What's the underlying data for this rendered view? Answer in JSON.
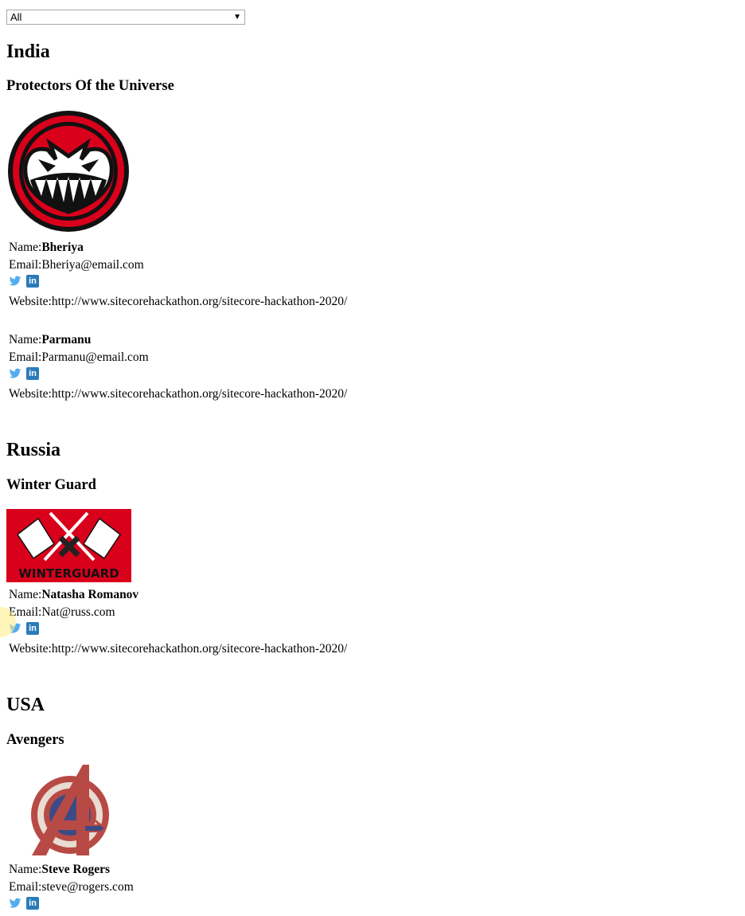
{
  "filter": {
    "selected": "All"
  },
  "sections": [
    {
      "country": "India",
      "team": "Protectors Of the Universe",
      "logo": "angry-face-logo",
      "members": [
        {
          "name_label": "Name:",
          "name": "Bheriya",
          "email_label": "Email:",
          "email": "Bheriya@email.com",
          "website_label": "Website:",
          "website": "http://www.sitecorehackathon.org/sitecore-hackathon-2020/"
        },
        {
          "name_label": "Name:",
          "name": "Parmanu",
          "email_label": "Email:",
          "email": "Parmanu@email.com",
          "website_label": "Website:",
          "website": "http://www.sitecorehackathon.org/sitecore-hackathon-2020/"
        }
      ]
    },
    {
      "country": "Russia",
      "team": "Winter Guard",
      "logo": "winterguard-logo",
      "logo_text": "WINTERGUARD",
      "members": [
        {
          "name_label": "Name:",
          "name": "Natasha Romanov",
          "email_label": "Email:",
          "email": "Nat@russ.com",
          "website_label": "Website:",
          "website": "http://www.sitecorehackathon.org/sitecore-hackathon-2020/"
        }
      ]
    },
    {
      "country": "USA",
      "team": "Avengers",
      "logo": "avengers-logo",
      "members": [
        {
          "name_label": "Name:",
          "name": "Steve Rogers",
          "email_label": "Email:",
          "email": "steve@rogers.com"
        }
      ]
    }
  ],
  "icons": {
    "twitter": "twitter-icon",
    "linkedin": "linkedin-icon",
    "linkedin_glyph": "in"
  },
  "colors": {
    "twitter": "#55acee",
    "linkedin": "#2b7bb9",
    "logo_red": "#d9001b"
  }
}
